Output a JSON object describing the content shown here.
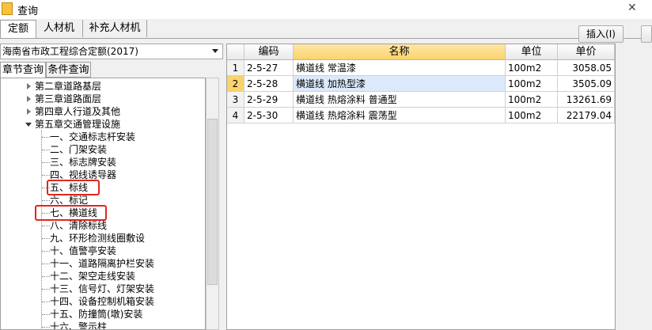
{
  "window": {
    "title": "查询"
  },
  "tabs": [
    "定额",
    "人材机",
    "补充人材机"
  ],
  "buttons": {
    "insert": "插入(I)"
  },
  "library": {
    "selected": "海南省市政工程综合定额(2017)"
  },
  "subtabs": [
    "章节查询",
    "条件查询"
  ],
  "tree": [
    {
      "label": "第二章道路基层",
      "level": 1,
      "state": "closed"
    },
    {
      "label": "第三章道路面层",
      "level": 1,
      "state": "closed"
    },
    {
      "label": "第四章人行道及其他",
      "level": 1,
      "state": "closed"
    },
    {
      "label": "第五章交通管理设施",
      "level": 1,
      "state": "open"
    },
    {
      "label": "一、交通标志杆安装",
      "level": 2
    },
    {
      "label": "二、门架安装",
      "level": 2
    },
    {
      "label": "三、标志牌安装",
      "level": 2
    },
    {
      "label": "四、视线诱导器",
      "level": 2
    },
    {
      "label": "五、标线",
      "level": 2,
      "boxed": true
    },
    {
      "label": "六、标记",
      "level": 2
    },
    {
      "label": "七、横道线",
      "level": 2,
      "boxed": true
    },
    {
      "label": "八、清除标线",
      "level": 2
    },
    {
      "label": "九、环形检测线圈敷设",
      "level": 2
    },
    {
      "label": "十、值警亭安装",
      "level": 2
    },
    {
      "label": "十一、道路隔离护栏安装",
      "level": 2
    },
    {
      "label": "十二、架空走线安装",
      "level": 2
    },
    {
      "label": "十三、信号灯、灯架安装",
      "level": 2
    },
    {
      "label": "十四、设备控制机箱安装",
      "level": 2
    },
    {
      "label": "十五、防撞筒(墩)安装",
      "level": 2
    },
    {
      "label": "十六、警示柱",
      "level": 2
    }
  ],
  "grid": {
    "headers": [
      "",
      "编码",
      "名称",
      "单位",
      "单价"
    ],
    "rows": [
      {
        "no": "1",
        "code": "2-5-27",
        "name": "横道线 常温漆",
        "unit": "100m2",
        "price": "3058.05"
      },
      {
        "no": "2",
        "code": "2-5-28",
        "name": "横道线 加热型漆",
        "unit": "100m2",
        "price": "3505.09"
      },
      {
        "no": "3",
        "code": "2-5-29",
        "name": "横道线 热熔涂料 普通型",
        "unit": "100m2",
        "price": "13261.69"
      },
      {
        "no": "4",
        "code": "2-5-30",
        "name": "横道线 热熔涂料 震荡型",
        "unit": "100m2",
        "price": "22179.04"
      }
    ],
    "current_row": 2
  },
  "colors": {
    "highlight_box": "#e0271d",
    "header_selected": "#fbd36b",
    "row_selected": "#dbe9fb"
  }
}
